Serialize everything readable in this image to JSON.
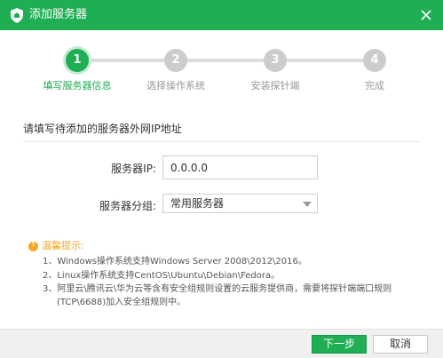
{
  "window": {
    "title": "添加服务器"
  },
  "colors": {
    "brand_green": "#1fae54",
    "inactive_grey": "#cccccc",
    "warning_orange": "#f5a623"
  },
  "icons": {
    "title_logo": "shield-icon",
    "close": "close-icon",
    "tip": "warning-icon",
    "select": "chevron-down-icon"
  },
  "steps": [
    {
      "number": "1",
      "label": "填写服务器信息",
      "active": true
    },
    {
      "number": "2",
      "label": "选择操作系统",
      "active": false
    },
    {
      "number": "3",
      "label": "安装探针端",
      "active": false
    },
    {
      "number": "4",
      "label": "完成",
      "active": false
    }
  ],
  "form": {
    "section_title": "请填写待添加的服务器外网IP地址",
    "ip_label": "服务器IP:",
    "ip_value": "0.0.0.0",
    "group_label": "服务器分组:",
    "group_value": "常用服务器"
  },
  "tips": {
    "heading": "温馨提示:",
    "items": [
      "1、Windows操作系统支持Windows Server 2008\\2012\\2016。",
      "2、Linux操作系统支持CentOS\\Ubuntu\\Debian\\Fedora。",
      "3、阿里云\\腾讯云\\华为云等含有安全组规则设置的云服务提供商，需要将探针端端口规则",
      "(TCP\\6688)加入安全组规则中。"
    ]
  },
  "buttons": {
    "next": "下一步",
    "cancel": "取消"
  }
}
